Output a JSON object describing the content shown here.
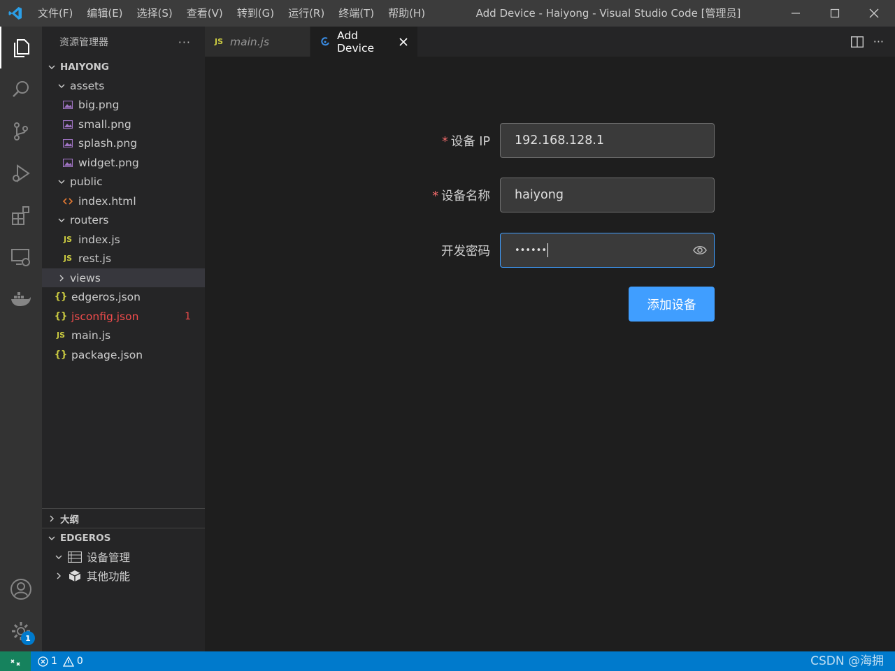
{
  "titlebar": {
    "menus": [
      "文件(F)",
      "编辑(E)",
      "选择(S)",
      "查看(V)",
      "转到(G)",
      "运行(R)",
      "终端(T)",
      "帮助(H)"
    ],
    "title": "Add Device - Haiyong - Visual Studio Code [管理员]"
  },
  "activity": {
    "icons": [
      "explorer-icon",
      "search-icon",
      "source-control-icon",
      "run-debug-icon",
      "extensions-icon",
      "remote-explorer-icon",
      "docker-icon",
      "account-icon",
      "settings-gear-icon"
    ],
    "settings_badge": "1"
  },
  "sidebar": {
    "header": "资源管理器",
    "more": "···",
    "project": "HAIYONG",
    "tree": [
      {
        "label": "assets",
        "type": "folder",
        "open": true,
        "depth": 1
      },
      {
        "label": "big.png",
        "type": "image",
        "depth": 2
      },
      {
        "label": "small.png",
        "type": "image",
        "depth": 2
      },
      {
        "label": "splash.png",
        "type": "image",
        "depth": 2
      },
      {
        "label": "widget.png",
        "type": "image",
        "depth": 2
      },
      {
        "label": "public",
        "type": "folder",
        "open": true,
        "depth": 1
      },
      {
        "label": "index.html",
        "type": "html",
        "depth": 2
      },
      {
        "label": "routers",
        "type": "folder",
        "open": true,
        "depth": 1
      },
      {
        "label": "index.js",
        "type": "js",
        "depth": 2
      },
      {
        "label": "rest.js",
        "type": "js",
        "depth": 2
      },
      {
        "label": "views",
        "type": "folder",
        "open": false,
        "depth": 1
      },
      {
        "label": "edgeros.json",
        "type": "json",
        "depth": 1
      },
      {
        "label": "jsconfig.json",
        "type": "json",
        "depth": 1,
        "error_count": "1"
      },
      {
        "label": "main.js",
        "type": "js",
        "depth": 1
      },
      {
        "label": "package.json",
        "type": "json",
        "depth": 1
      }
    ],
    "outline": "大纲",
    "edgeros": "EDGEROS",
    "edgeros_items": [
      {
        "label": "设备管理",
        "open": true
      },
      {
        "label": "其他功能",
        "open": false
      }
    ]
  },
  "tabs": [
    {
      "label": "main.js",
      "icon": "JS",
      "active": false
    },
    {
      "label": "Add Device",
      "active": true
    }
  ],
  "form": {
    "ip_label": "设备 IP",
    "ip_value": "192.168.128.1",
    "name_label": "设备名称",
    "name_value": "haiyong",
    "password_label": "开发密码",
    "password_value": "••••••",
    "submit": "添加设备",
    "required_mark": "*"
  },
  "statusbar": {
    "errors": "1",
    "warnings": "0",
    "watermark": "CSDN @海拥"
  }
}
